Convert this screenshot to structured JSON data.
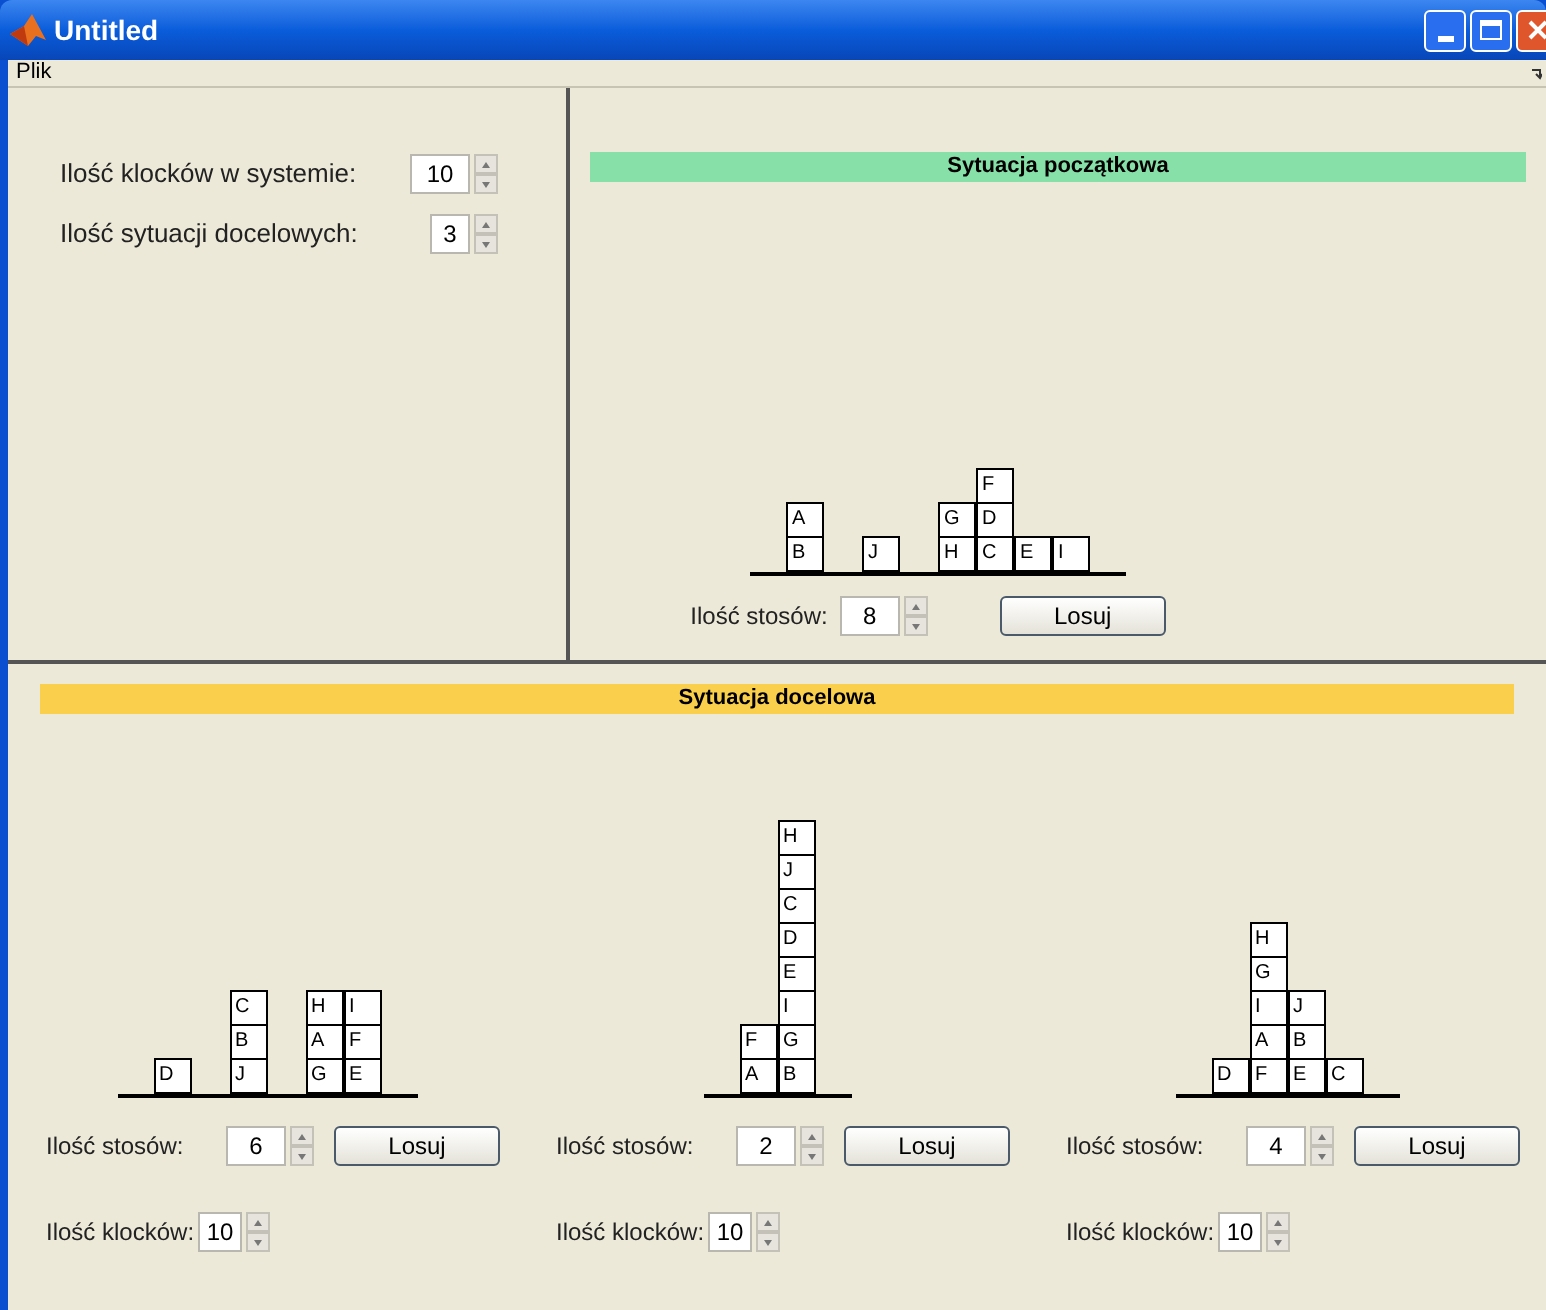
{
  "window": {
    "title": "Untitled"
  },
  "menu": [
    "Plik"
  ],
  "settings": [
    {
      "label": "Ilość klocków w systemie:",
      "value": "10"
    },
    {
      "label": "Ilość sytuacji docelowych:",
      "value": "3"
    }
  ],
  "initial": {
    "title": "Sytuacja początkowa",
    "stacks": [
      {
        "kind": "stack",
        "blocks": [
          "B",
          "A"
        ]
      },
      {
        "kind": "gap"
      },
      {
        "kind": "stack",
        "blocks": [
          "J"
        ]
      },
      {
        "kind": "gap"
      },
      {
        "kind": "stack",
        "blocks": [
          "H",
          "G"
        ]
      },
      {
        "kind": "stack",
        "blocks": [
          "C",
          "D",
          "F"
        ]
      },
      {
        "kind": "stack",
        "blocks": [
          "E"
        ]
      },
      {
        "kind": "stack",
        "blocks": [
          "I"
        ]
      }
    ],
    "stack_count": {
      "label": "Ilość stosów:",
      "value": "8"
    },
    "button": "Losuj"
  },
  "target": {
    "title": "Sytuacja docelowa",
    "scenarios": [
      {
        "stacks": [
          {
            "kind": "stack",
            "blocks": [
              "D"
            ]
          },
          {
            "kind": "gap"
          },
          {
            "kind": "stack",
            "blocks": [
              "J",
              "B",
              "C"
            ]
          },
          {
            "kind": "gap"
          },
          {
            "kind": "stack",
            "blocks": [
              "G",
              "A",
              "H"
            ]
          },
          {
            "kind": "stack",
            "blocks": [
              "E",
              "F",
              "I"
            ]
          }
        ],
        "stack_count": {
          "label": "Ilość stosów:",
          "value": "6"
        },
        "button": "Losuj",
        "block_count": {
          "label": "Ilość klocków:",
          "value": "10"
        }
      },
      {
        "stacks": [
          {
            "kind": "stack",
            "blocks": [
              "A",
              "F"
            ]
          },
          {
            "kind": "stack",
            "blocks": [
              "B",
              "G",
              "I",
              "E",
              "D",
              "C",
              "J",
              "H"
            ]
          }
        ],
        "stack_count": {
          "label": "Ilość stosów:",
          "value": "2"
        },
        "button": "Losuj",
        "block_count": {
          "label": "Ilość klocków:",
          "value": "10"
        }
      },
      {
        "stacks": [
          {
            "kind": "stack",
            "blocks": [
              "D"
            ]
          },
          {
            "kind": "stack",
            "blocks": [
              "F",
              "A",
              "I",
              "G",
              "H"
            ]
          },
          {
            "kind": "stack",
            "blocks": [
              "E",
              "B",
              "J"
            ]
          },
          {
            "kind": "stack",
            "blocks": [
              "C"
            ]
          }
        ],
        "stack_count": {
          "label": "Ilość stosów:",
          "value": "4"
        },
        "button": "Losuj",
        "block_count": {
          "label": "Ilość klocków:",
          "value": "10"
        }
      }
    ]
  }
}
